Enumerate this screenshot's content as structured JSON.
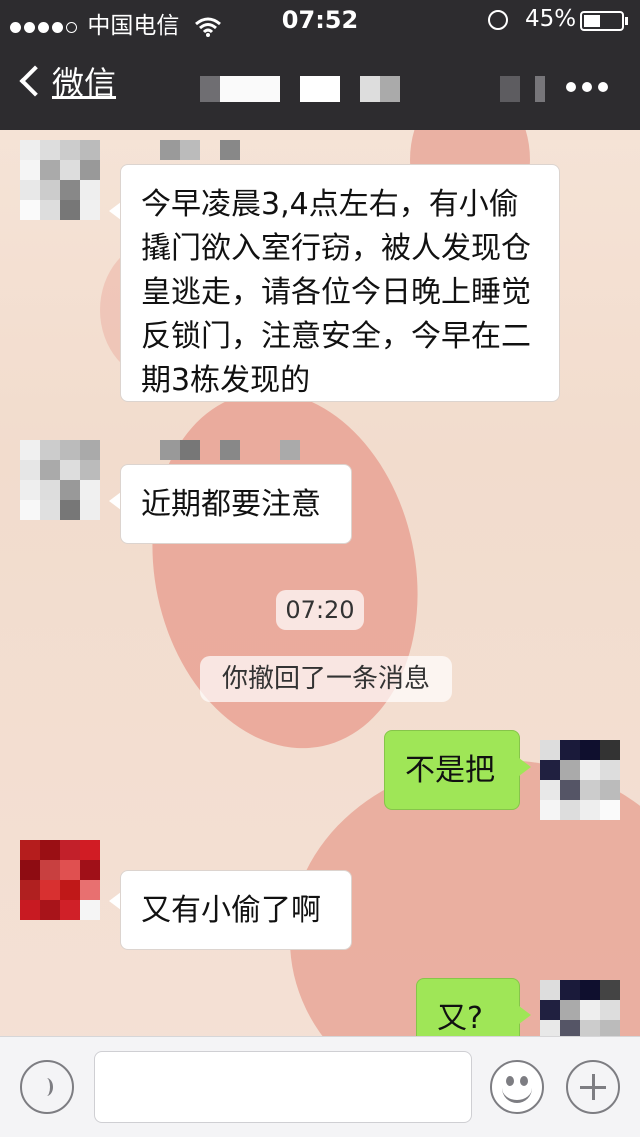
{
  "status_bar": {
    "carrier": "中国电信",
    "time": "07:52",
    "battery": "45%"
  },
  "nav": {
    "back_label": "微信",
    "title": ""
  },
  "messages": [
    {
      "side": "incoming",
      "text": "今早凌晨3,4点左右，有小偷撬门欲入室行窃，被人发现仓皇逃走，请各位今日晚上睡觉反锁门，注意安全，今早在二期3栋发现的"
    },
    {
      "side": "incoming",
      "text": "近期都要注意"
    },
    {
      "type": "time",
      "text": "07:20"
    },
    {
      "type": "system",
      "text": "你撤回了一条消息"
    },
    {
      "side": "outgoing",
      "text": "不是把"
    },
    {
      "side": "incoming",
      "text": "又有小偷了啊"
    },
    {
      "side": "outgoing",
      "text": "又?"
    }
  ],
  "colors": {
    "bar": "#2d2c2f",
    "outgoing_bubble": "#9fe657",
    "incoming_bubble": "#ffffff"
  },
  "icons": {
    "voice": "voice-icon",
    "emoji": "emoji-icon",
    "plus": "plus-icon",
    "more": "more-icon"
  }
}
